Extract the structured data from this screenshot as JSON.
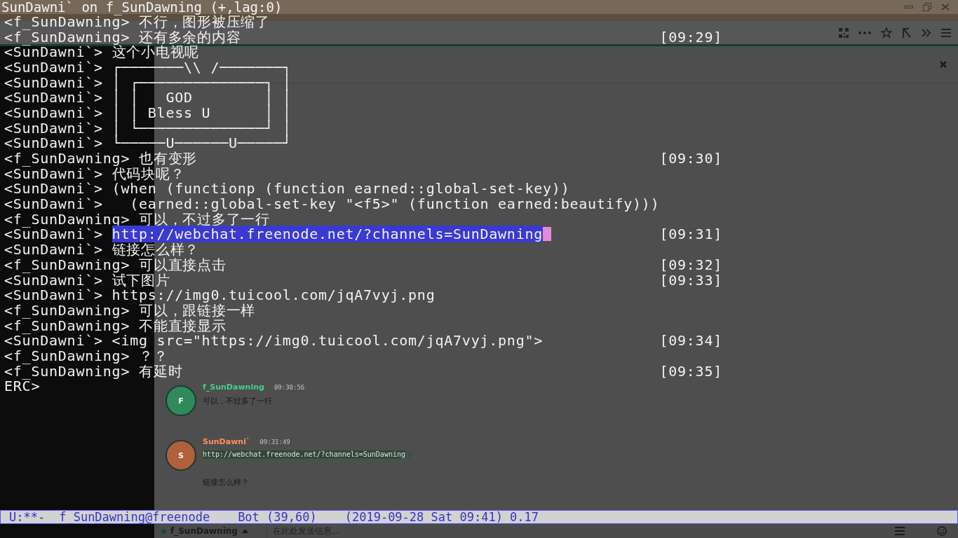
{
  "window": {
    "title": "SunDawni` on f_SunDawning (+,lag:0)"
  },
  "buffer": {
    "lines": [
      {
        "nick": "<f_SunDawning>",
        "text": "不行，图形被压缩了",
        "highlighted": false
      },
      {
        "nick": "<f_SunDawning>",
        "text": "还有多余的内容",
        "time": "[09:29]",
        "highlighted": false
      },
      {
        "nick": "<SunDawni`>",
        "text": "这个小电视呢",
        "highlighted": false
      },
      {
        "nick": "<SunDawni`>",
        "text": "┌───────\\\\ /───────┐",
        "highlighted": false
      },
      {
        "nick": "<SunDawni`>",
        "text": "│ ┌──────────────┐ │",
        "highlighted": false
      },
      {
        "nick": "<SunDawni`>",
        "text": "│ │   GOD        │ │",
        "highlighted": false
      },
      {
        "nick": "<SunDawni`>",
        "text": "│ │ Bless U      │ │",
        "highlighted": false
      },
      {
        "nick": "<SunDawni`>",
        "text": "│ └──────────────┘ │",
        "highlighted": false
      },
      {
        "nick": "<SunDawni`>",
        "text": "└─────U──────U─────┘",
        "highlighted": false
      },
      {
        "nick": "<f_SunDawning>",
        "text": "也有变形",
        "time": "[09:30]",
        "highlighted": false
      },
      {
        "nick": "<SunDawni`>",
        "text": "代码块呢？",
        "highlighted": false
      },
      {
        "nick": "<SunDawni`>",
        "text": "(when (functionp (function earned::global-set-key))",
        "highlighted": false
      },
      {
        "nick": "<SunDawni`>",
        "text": "  (earned::global-set-key \"<f5>\" (function earned:beautify)))",
        "highlighted": false
      },
      {
        "nick": "<f_SunDawning>",
        "text": "可以，不过多了一行",
        "highlighted": false
      },
      {
        "nick": "<SunDawni`>",
        "text": "http://webchat.freenode.net/?channels=SunDawning",
        "time": "[09:31]",
        "highlighted": true
      },
      {
        "nick": "<SunDawni`>",
        "text": "链接怎么样？",
        "highlighted": false
      },
      {
        "nick": "<f_SunDawning>",
        "text": "可以直接点击",
        "time": "[09:32]",
        "highlighted": false
      },
      {
        "nick": "<SunDawni`>",
        "text": "试下图片",
        "time": "[09:33]",
        "highlighted": false
      },
      {
        "nick": "<SunDawni`>",
        "text": "https://img0.tuicool.com/jqA7vyj.png",
        "highlighted": false
      },
      {
        "nick": "<f_SunDawning>",
        "text": "可以，跟链接一样",
        "highlighted": false
      },
      {
        "nick": "<f_SunDawning>",
        "text": "不能直接显示",
        "highlighted": false
      },
      {
        "nick": "<SunDawni`>",
        "text": "<img src=\"https://img0.tuicool.com/jqA7vyj.png\">",
        "time": "[09:34]",
        "highlighted": false
      },
      {
        "nick": "<f_SunDawning>",
        "text": "？？",
        "highlighted": false
      },
      {
        "nick": "<f_SunDawning>",
        "text": "有延时",
        "time": "[09:35]",
        "highlighted": false
      }
    ],
    "prompt": "ERC>"
  },
  "mode_line": {
    "status": "U:**-",
    "buffer": "f_SunDawning@freenode",
    "mode": "Bot (39,60)",
    "time": "(2019-09-28 Sat 09:41) 0.17"
  },
  "background_chat": {
    "messages": [
      {
        "avatar": "F",
        "nick": "f_SunDawning",
        "time": "09:30:56",
        "color": "#2f8a5c",
        "texts": [
          {
            "kind": "text",
            "text": "可以，不过多了一行"
          }
        ]
      },
      {
        "avatar": "S",
        "nick": "SunDawni`",
        "time": "09:31:49",
        "color": "#b0603c",
        "texts": [
          {
            "kind": "link",
            "text": "http://webchat.freenode.net/?channels=SunDawning"
          },
          {
            "kind": "text",
            "text": "链接怎么样？"
          }
        ]
      }
    ]
  },
  "background_footer": {
    "channel": "f_SunDawning",
    "input_placeholder": "在此处发送信息…"
  }
}
